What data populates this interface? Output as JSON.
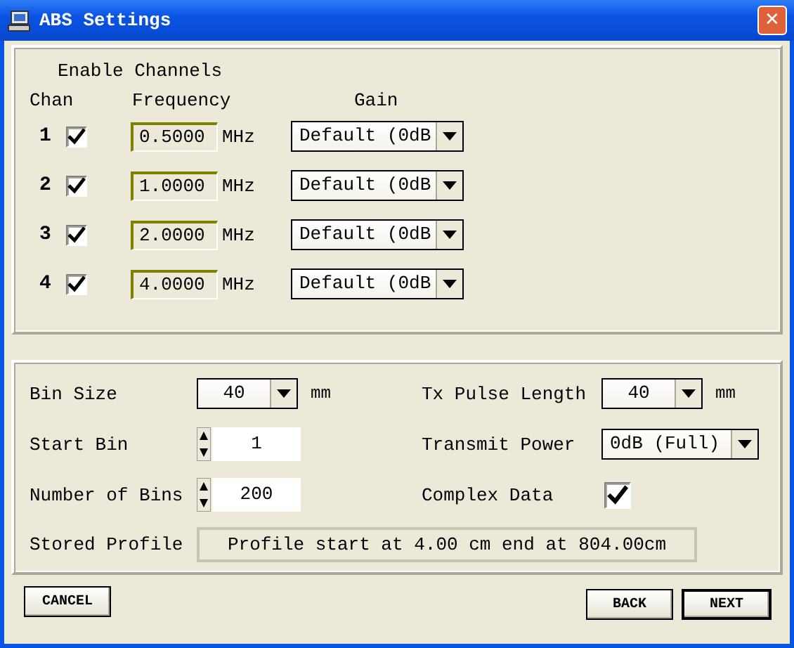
{
  "window": {
    "title": "ABS Settings",
    "close": "✕"
  },
  "channels_panel": {
    "title": "Enable Channels",
    "headers": [
      "Chan",
      "Frequency",
      "Gain"
    ],
    "channels": [
      {
        "number": "1",
        "enabled": true,
        "frequency": "0.5000",
        "unit": "MHz",
        "gain": "Default (0dB"
      },
      {
        "number": "2",
        "enabled": true,
        "frequency": "1.0000",
        "unit": "MHz",
        "gain": "Default (0dB"
      },
      {
        "number": "3",
        "enabled": true,
        "frequency": "2.0000",
        "unit": "MHz",
        "gain": "Default (0dB"
      },
      {
        "number": "4",
        "enabled": true,
        "frequency": "4.0000",
        "unit": "MHz",
        "gain": "Default (0dB"
      }
    ]
  },
  "settings": {
    "bin_size": {
      "label": "Bin Size",
      "value": "40",
      "unit": "mm"
    },
    "start_bin": {
      "label": "Start Bin",
      "value": "1"
    },
    "number_of_bins": {
      "label": "Number of Bins",
      "value": "200"
    },
    "tx_pulse_length": {
      "label": "Tx Pulse Length",
      "value": "40",
      "unit": "mm"
    },
    "transmit_power": {
      "label": "Transmit Power",
      "value": "0dB (Full)"
    },
    "complex_data": {
      "label": "Complex Data",
      "checked": true
    },
    "stored_profile": {
      "label": "Stored Profile",
      "value": "Profile start at 4.00 cm end at 804.00cm"
    }
  },
  "buttons": [
    {
      "label": "CANCEL",
      "default": false
    },
    {
      "label": "BACK",
      "default": false
    },
    {
      "label": "NEXT",
      "default": true
    }
  ]
}
